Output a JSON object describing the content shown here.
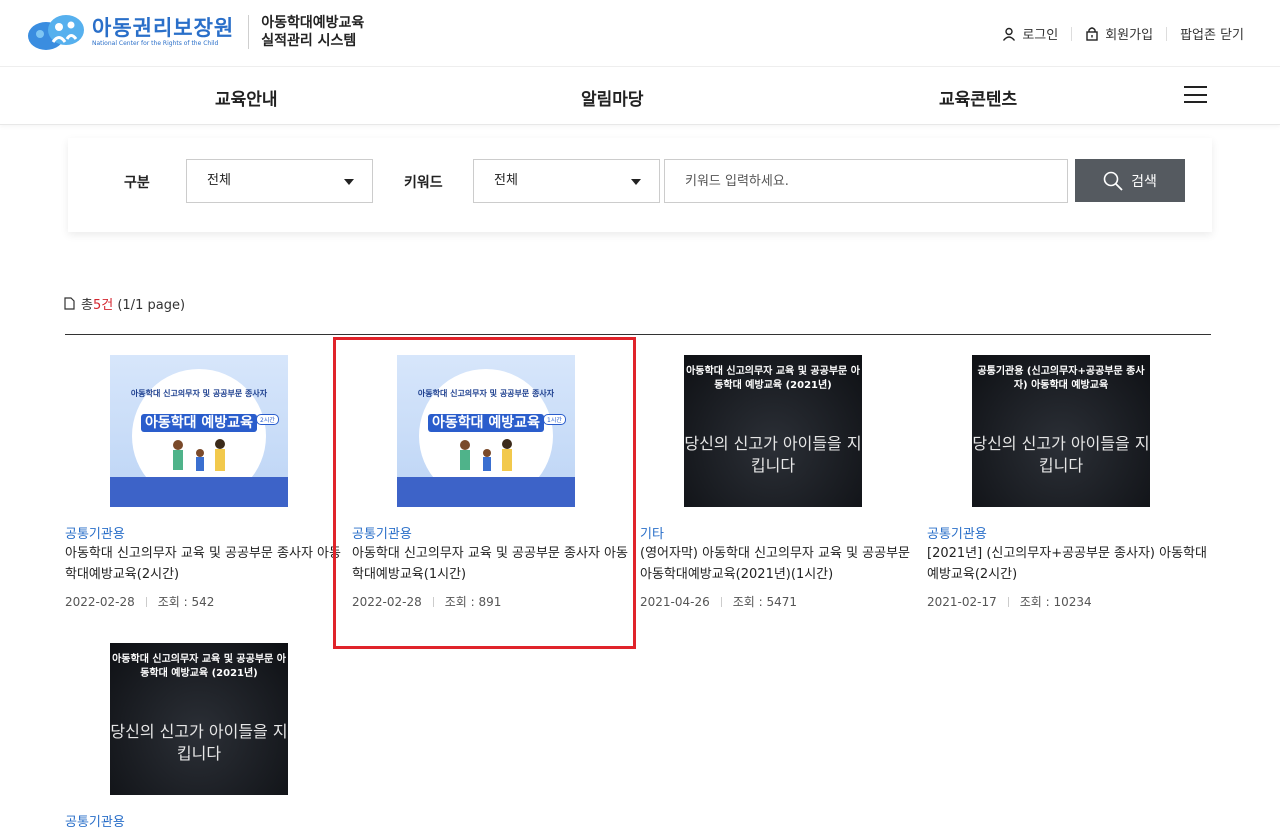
{
  "header": {
    "logo_name": "아동권리보장원",
    "logo_sub": "National Center for the Rights of the Child",
    "system_line1": "아동학대예방교육",
    "system_line2": "실적관리 시스템",
    "login": "로그인",
    "signup": "회원가입",
    "popup_close": "팝업존 닫기"
  },
  "nav": {
    "items": [
      "교육안내",
      "알림마당",
      "교육콘텐츠"
    ]
  },
  "search": {
    "category_label": "구분",
    "category_value": "전체",
    "keyword_label": "키워드",
    "keyword_value": "전체",
    "input_placeholder": "키워드 입력하세요.",
    "button_label": "검색"
  },
  "summary": {
    "prefix": "총",
    "count": "5건",
    "pages": "(1/1 page)"
  },
  "cards": [
    {
      "category": "공통기관용",
      "title": "아동학대 신고의무자 교육 및 공공부문 종사자 아동학대예방교육(2시간)",
      "date": "2022-02-28",
      "views": "조회 : 542",
      "thumb_small": "아동학대 신고의무자 및 공공부문 종사자",
      "thumb_big": "아동학대 예방교육",
      "thumb_badge": "2시간"
    },
    {
      "category": "공통기관용",
      "title": "아동학대 신고의무자 교육 및 공공부문 종사자 아동학대예방교육(1시간)",
      "date": "2022-02-28",
      "views": "조회 : 891",
      "thumb_small": "아동학대 신고의무자 및 공공부문 종사자",
      "thumb_big": "아동학대 예방교육",
      "thumb_badge": "1시간"
    },
    {
      "category": "기타",
      "title": "(영어자막) 아동학대 신고의무자 교육 및 공공부문 아동학대예방교육(2021년)(1시간)",
      "date": "2021-04-26",
      "views": "조회 : 5471",
      "thumb_top": "아동학대 신고의무자 교육 및 공공부문 아동학대 예방교육 (2021년)",
      "thumb_big": "당신의 신고가 아이들을 지킵니다"
    },
    {
      "category": "공통기관용",
      "title": "[2021년] (신고의무자+공공부문 종사자) 아동학대 예방교육(2시간)",
      "date": "2021-02-17",
      "views": "조회 : 10234",
      "thumb_top": "공통기관용 (신고의무자+공공부문 종사자) 아동학대 예방교육",
      "thumb_big": "당신의 신고가 아이들을 지킵니다"
    },
    {
      "category": "공통기관용",
      "thumb_top": "아동학대 신고의무자 교육 및 공공부문 아동학대 예방교육 (2021년)",
      "thumb_big": "당신의 신고가 아이들을 지킵니다"
    }
  ],
  "colors": {
    "brand_blue": "#2a6fc9",
    "highlight_red": "#e0232a",
    "search_button": "#555a60"
  }
}
